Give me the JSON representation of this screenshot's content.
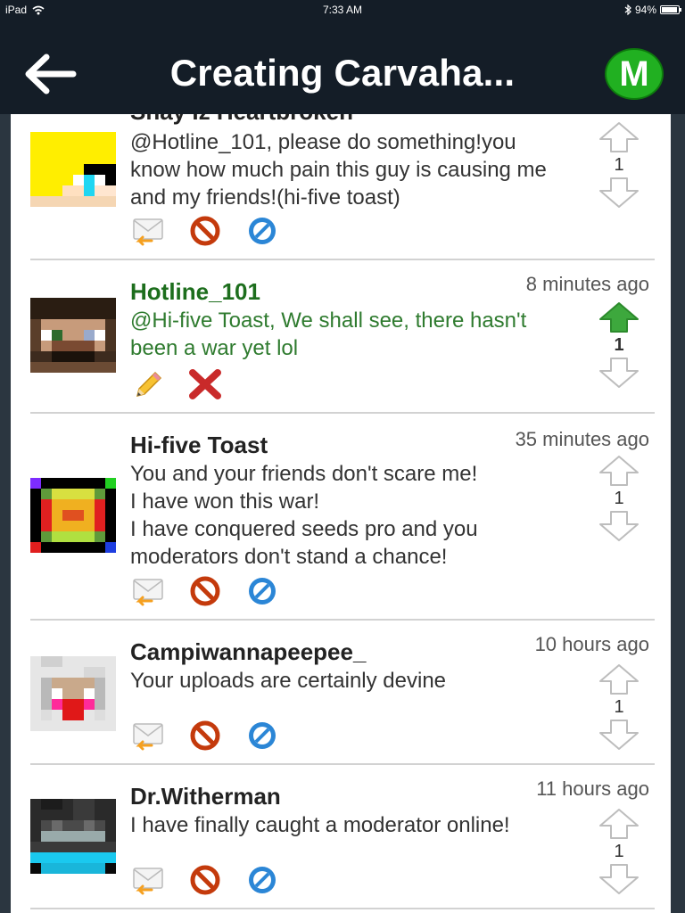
{
  "status_bar": {
    "device": "iPad",
    "time": "7:33 AM",
    "battery": "94%"
  },
  "nav": {
    "title": "Creating Carvaha...",
    "badge": "M"
  },
  "colors": {
    "nav_bg": "#141d27",
    "badge_green": "#21b021",
    "author_green": "#1d6e1d",
    "upvote_active": "#3da83d"
  },
  "comments": [
    {
      "author": "Shay Iz Heartbroken",
      "time_ago": "",
      "text": "@Hotline_101, please do something!you know how much pain this guy is causing me and my friends!(hi-five toast)",
      "votes": "1",
      "actions": [
        "reply-icon",
        "block-icon",
        "report-icon"
      ]
    },
    {
      "author": "Hotline_101",
      "time_ago": "8 minutes ago",
      "text": "@Hi-five Toast, We shall see, there hasn't been a war yet lol",
      "votes": "1",
      "actions": [
        "edit-icon",
        "delete-icon"
      ]
    },
    {
      "author": "Hi-five Toast",
      "time_ago": "35 minutes ago",
      "text": "You and your friends don't scare me!\nI have won this war!\nI have conquered seeds pro and you moderators don't stand a chance!",
      "votes": "1",
      "actions": [
        "reply-icon",
        "block-icon",
        "report-icon"
      ]
    },
    {
      "author": "Campiwannapeepee_",
      "time_ago": "10 hours ago",
      "text": "Your uploads are certainly devine",
      "votes": "1",
      "actions": [
        "reply-icon",
        "block-icon",
        "report-icon"
      ]
    },
    {
      "author": "Dr.Witherman",
      "time_ago": "11 hours ago",
      "text": "I have finally caught a moderator online!",
      "votes": "1",
      "actions": [
        "reply-icon",
        "block-icon",
        "report-icon"
      ]
    }
  ]
}
